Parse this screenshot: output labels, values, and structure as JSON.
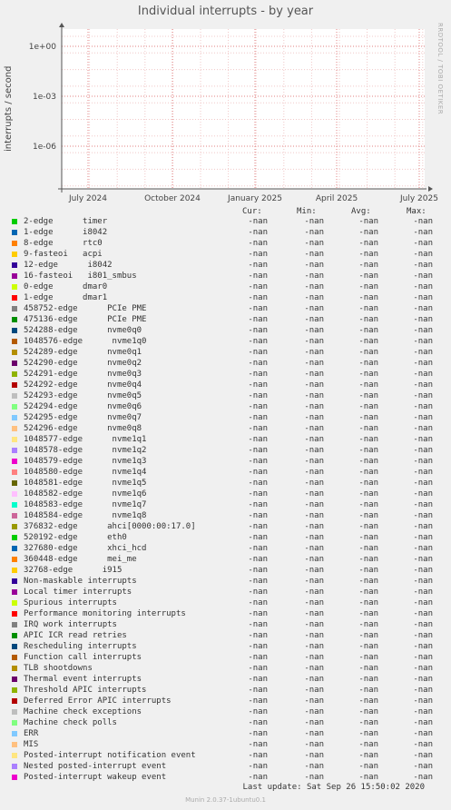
{
  "title": "Individual interrupts - by year",
  "side_label": "RRDTOOL / TOBI OETIKER",
  "footer": "Munin 2.0.37-1ubuntu0.1",
  "last_update": "Last update: Sat Sep 26 15:50:02 2020",
  "legend_header": {
    "cur": "Cur:",
    "min": "Min:",
    "avg": "Avg:",
    "max": "Max:"
  },
  "chart_data": {
    "type": "line",
    "title": "Individual interrupts - by year",
    "ylabel": "interrupts / second",
    "yscale": "log",
    "y_ticks": [
      "1e+00",
      "1e-03",
      "1e-06"
    ],
    "x_ticks": [
      "July 2024",
      "October 2024",
      "January 2025",
      "April 2025",
      "July 2025"
    ],
    "grid": true,
    "series": []
  },
  "legend": [
    {
      "label": "2-edge      timer",
      "color": "#00cc00",
      "cur": "-nan",
      "min": "-nan",
      "avg": "-nan",
      "max": "-nan"
    },
    {
      "label": "1-edge      i8042",
      "color": "#0066b3",
      "cur": "-nan",
      "min": "-nan",
      "avg": "-nan",
      "max": "-nan"
    },
    {
      "label": "8-edge      rtc0",
      "color": "#ff8000",
      "cur": "-nan",
      "min": "-nan",
      "avg": "-nan",
      "max": "-nan"
    },
    {
      "label": "9-fasteoi   acpi",
      "color": "#ffcc00",
      "cur": "-nan",
      "min": "-nan",
      "avg": "-nan",
      "max": "-nan"
    },
    {
      "label": "12-edge      i8042",
      "color": "#330099",
      "cur": "-nan",
      "min": "-nan",
      "avg": "-nan",
      "max": "-nan"
    },
    {
      "label": "16-fasteoi   i801_smbus",
      "color": "#990099",
      "cur": "-nan",
      "min": "-nan",
      "avg": "-nan",
      "max": "-nan"
    },
    {
      "label": "0-edge      dmar0",
      "color": "#ccff00",
      "cur": "-nan",
      "min": "-nan",
      "avg": "-nan",
      "max": "-nan"
    },
    {
      "label": "1-edge      dmar1",
      "color": "#ff0000",
      "cur": "-nan",
      "min": "-nan",
      "avg": "-nan",
      "max": "-nan"
    },
    {
      "label": "458752-edge      PCIe PME",
      "color": "#808080",
      "cur": "-nan",
      "min": "-nan",
      "avg": "-nan",
      "max": "-nan"
    },
    {
      "label": "475136-edge      PCIe PME",
      "color": "#008f00",
      "cur": "-nan",
      "min": "-nan",
      "avg": "-nan",
      "max": "-nan"
    },
    {
      "label": "524288-edge      nvme0q0",
      "color": "#00487d",
      "cur": "-nan",
      "min": "-nan",
      "avg": "-nan",
      "max": "-nan"
    },
    {
      "label": "1048576-edge      nvme1q0",
      "color": "#b35a00",
      "cur": "-nan",
      "min": "-nan",
      "avg": "-nan",
      "max": "-nan"
    },
    {
      "label": "524289-edge      nvme0q1",
      "color": "#b38f00",
      "cur": "-nan",
      "min": "-nan",
      "avg": "-nan",
      "max": "-nan"
    },
    {
      "label": "524290-edge      nvme0q2",
      "color": "#6b006b",
      "cur": "-nan",
      "min": "-nan",
      "avg": "-nan",
      "max": "-nan"
    },
    {
      "label": "524291-edge      nvme0q3",
      "color": "#8fb300",
      "cur": "-nan",
      "min": "-nan",
      "avg": "-nan",
      "max": "-nan"
    },
    {
      "label": "524292-edge      nvme0q4",
      "color": "#b30000",
      "cur": "-nan",
      "min": "-nan",
      "avg": "-nan",
      "max": "-nan"
    },
    {
      "label": "524293-edge      nvme0q5",
      "color": "#bebebe",
      "cur": "-nan",
      "min": "-nan",
      "avg": "-nan",
      "max": "-nan"
    },
    {
      "label": "524294-edge      nvme0q6",
      "color": "#80ff80",
      "cur": "-nan",
      "min": "-nan",
      "avg": "-nan",
      "max": "-nan"
    },
    {
      "label": "524295-edge      nvme0q7",
      "color": "#80c9ff",
      "cur": "-nan",
      "min": "-nan",
      "avg": "-nan",
      "max": "-nan"
    },
    {
      "label": "524296-edge      nvme0q8",
      "color": "#ffc080",
      "cur": "-nan",
      "min": "-nan",
      "avg": "-nan",
      "max": "-nan"
    },
    {
      "label": "1048577-edge      nvme1q1",
      "color": "#ffe680",
      "cur": "-nan",
      "min": "-nan",
      "avg": "-nan",
      "max": "-nan"
    },
    {
      "label": "1048578-edge      nvme1q2",
      "color": "#aa80ff",
      "cur": "-nan",
      "min": "-nan",
      "avg": "-nan",
      "max": "-nan"
    },
    {
      "label": "1048579-edge      nvme1q3",
      "color": "#ee00cc",
      "cur": "-nan",
      "min": "-nan",
      "avg": "-nan",
      "max": "-nan"
    },
    {
      "label": "1048580-edge      nvme1q4",
      "color": "#ff8080",
      "cur": "-nan",
      "min": "-nan",
      "avg": "-nan",
      "max": "-nan"
    },
    {
      "label": "1048581-edge      nvme1q5",
      "color": "#666600",
      "cur": "-nan",
      "min": "-nan",
      "avg": "-nan",
      "max": "-nan"
    },
    {
      "label": "1048582-edge      nvme1q6",
      "color": "#ffbfff",
      "cur": "-nan",
      "min": "-nan",
      "avg": "-nan",
      "max": "-nan"
    },
    {
      "label": "1048583-edge      nvme1q7",
      "color": "#00ffcc",
      "cur": "-nan",
      "min": "-nan",
      "avg": "-nan",
      "max": "-nan"
    },
    {
      "label": "1048584-edge      nvme1q8",
      "color": "#cc6699",
      "cur": "-nan",
      "min": "-nan",
      "avg": "-nan",
      "max": "-nan"
    },
    {
      "label": "376832-edge      ahci[0000:00:17.0]",
      "color": "#999900",
      "cur": "-nan",
      "min": "-nan",
      "avg": "-nan",
      "max": "-nan"
    },
    {
      "label": "520192-edge      eth0",
      "color": "#00cc00",
      "cur": "-nan",
      "min": "-nan",
      "avg": "-nan",
      "max": "-nan"
    },
    {
      "label": "327680-edge      xhci_hcd",
      "color": "#0066b3",
      "cur": "-nan",
      "min": "-nan",
      "avg": "-nan",
      "max": "-nan"
    },
    {
      "label": "360448-edge      mei_me",
      "color": "#ff8000",
      "cur": "-nan",
      "min": "-nan",
      "avg": "-nan",
      "max": "-nan"
    },
    {
      "label": "32768-edge      i915",
      "color": "#ffcc00",
      "cur": "-nan",
      "min": "-nan",
      "avg": "-nan",
      "max": "-nan"
    },
    {
      "label": "Non-maskable interrupts",
      "color": "#330099",
      "cur": "-nan",
      "min": "-nan",
      "avg": "-nan",
      "max": "-nan"
    },
    {
      "label": "Local timer interrupts",
      "color": "#990099",
      "cur": "-nan",
      "min": "-nan",
      "avg": "-nan",
      "max": "-nan"
    },
    {
      "label": "Spurious interrupts",
      "color": "#ccff00",
      "cur": "-nan",
      "min": "-nan",
      "avg": "-nan",
      "max": "-nan"
    },
    {
      "label": "Performance monitoring interrupts",
      "color": "#ff0000",
      "cur": "-nan",
      "min": "-nan",
      "avg": "-nan",
      "max": "-nan"
    },
    {
      "label": "IRQ work interrupts",
      "color": "#808080",
      "cur": "-nan",
      "min": "-nan",
      "avg": "-nan",
      "max": "-nan"
    },
    {
      "label": "APIC ICR read retries",
      "color": "#008f00",
      "cur": "-nan",
      "min": "-nan",
      "avg": "-nan",
      "max": "-nan"
    },
    {
      "label": "Rescheduling interrupts",
      "color": "#00487d",
      "cur": "-nan",
      "min": "-nan",
      "avg": "-nan",
      "max": "-nan"
    },
    {
      "label": "Function call interrupts",
      "color": "#b35a00",
      "cur": "-nan",
      "min": "-nan",
      "avg": "-nan",
      "max": "-nan"
    },
    {
      "label": "TLB shootdowns",
      "color": "#b38f00",
      "cur": "-nan",
      "min": "-nan",
      "avg": "-nan",
      "max": "-nan"
    },
    {
      "label": "Thermal event interrupts",
      "color": "#6b006b",
      "cur": "-nan",
      "min": "-nan",
      "avg": "-nan",
      "max": "-nan"
    },
    {
      "label": "Threshold APIC interrupts",
      "color": "#8fb300",
      "cur": "-nan",
      "min": "-nan",
      "avg": "-nan",
      "max": "-nan"
    },
    {
      "label": "Deferred Error APIC interrupts",
      "color": "#b30000",
      "cur": "-nan",
      "min": "-nan",
      "avg": "-nan",
      "max": "-nan"
    },
    {
      "label": "Machine check exceptions",
      "color": "#bebebe",
      "cur": "-nan",
      "min": "-nan",
      "avg": "-nan",
      "max": "-nan"
    },
    {
      "label": "Machine check polls",
      "color": "#80ff80",
      "cur": "-nan",
      "min": "-nan",
      "avg": "-nan",
      "max": "-nan"
    },
    {
      "label": "ERR",
      "color": "#80c9ff",
      "cur": "-nan",
      "min": "-nan",
      "avg": "-nan",
      "max": "-nan"
    },
    {
      "label": "MIS",
      "color": "#ffc080",
      "cur": "-nan",
      "min": "-nan",
      "avg": "-nan",
      "max": "-nan"
    },
    {
      "label": "Posted-interrupt notification event",
      "color": "#ffe680",
      "cur": "-nan",
      "min": "-nan",
      "avg": "-nan",
      "max": "-nan"
    },
    {
      "label": "Nested posted-interrupt event",
      "color": "#aa80ff",
      "cur": "-nan",
      "min": "-nan",
      "avg": "-nan",
      "max": "-nan"
    },
    {
      "label": "Posted-interrupt wakeup event",
      "color": "#ee00cc",
      "cur": "-nan",
      "min": "-nan",
      "avg": "-nan",
      "max": "-nan"
    }
  ]
}
